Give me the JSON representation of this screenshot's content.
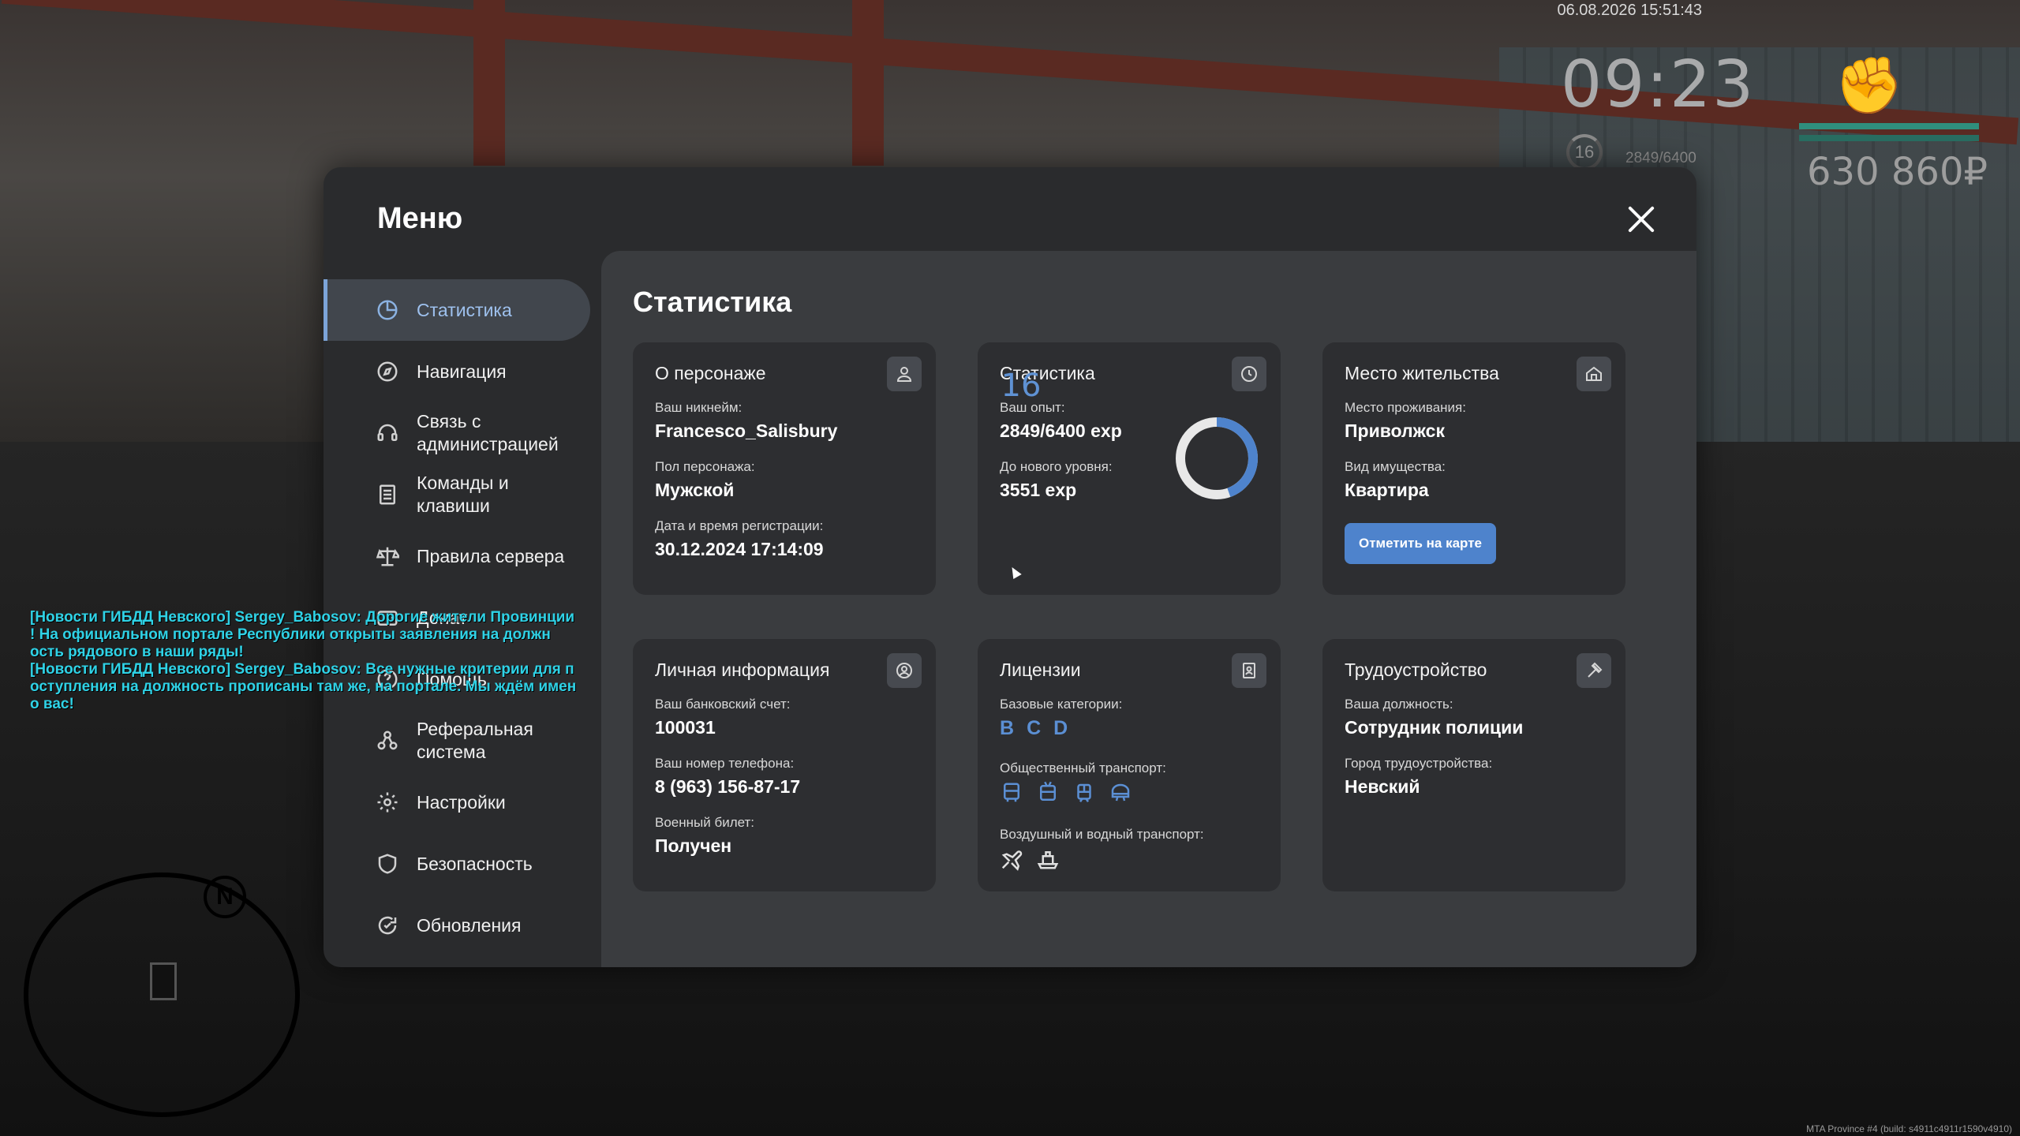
{
  "hud": {
    "datetime": "06.08.2026 15:51:43",
    "clock": "09:23",
    "level": "16",
    "exp": "2849/6400",
    "money": "630 860₽"
  },
  "chat": {
    "lines": [
      "[Новости ГИБДД Невского] Sergey_Babosov: Дорогие жители Провинции",
      "! На официальном портале Республики открыты заявления на должн",
      "ость рядового в наши ряды!",
      "[Новости ГИБДД Невского] Sergey_Babosov: Все нужные критерии для п",
      "оступления на должность прописаны там же, на портале. Мы ждём имен",
      "о вас!"
    ]
  },
  "minimap": {
    "north": "N"
  },
  "footer": {
    "build": "MTA Province #4 (build: s4911c4911r1590v4910)"
  },
  "menu": {
    "title": "Меню",
    "nav": [
      {
        "label": "Статистика",
        "icon": "pie-chart-icon",
        "active": true
      },
      {
        "label": "Навигация",
        "icon": "compass-icon"
      },
      {
        "label": "Связь с\nадминистрацией",
        "icon": "headset-icon"
      },
      {
        "label": "Команды и\nклавиши",
        "icon": "document-icon"
      },
      {
        "label": "Правила сервера",
        "icon": "scales-icon"
      },
      {
        "label": "Донат",
        "icon": "wallet-icon"
      },
      {
        "label": "Помощь",
        "icon": "help-icon"
      },
      {
        "label": "Реферальная\nсистема",
        "icon": "referral-icon"
      },
      {
        "label": "Настройки",
        "icon": "gear-icon"
      },
      {
        "label": "Безопасность",
        "icon": "shield-icon"
      },
      {
        "label": "Обновления",
        "icon": "refresh-icon"
      }
    ],
    "content_title": "Статистика",
    "cards": {
      "character": {
        "title": "О персонаже",
        "nick_label": "Ваш никнейм:",
        "nick": "Francesco_Salisbury",
        "gender_label": "Пол персонажа:",
        "gender": "Мужской",
        "reg_label": "Дата и время регистрации:",
        "reg": "30.12.2024 17:14:09"
      },
      "stats": {
        "title": "Статистика",
        "exp_label": "Ваш опыт:",
        "exp": "2849/6400 exp",
        "next_label": "До нового уровня:",
        "next": "3551 exp",
        "level": "16",
        "progress": 0.445
      },
      "residence": {
        "title": "Место жительства",
        "place_label": "Место проживания:",
        "place": "Приволжск",
        "prop_label": "Вид имущества:",
        "prop": "Квартира",
        "button": "Отметить на карте"
      },
      "personal": {
        "title": "Личная информация",
        "bank_label": "Ваш банковский счет:",
        "bank": "100031",
        "phone_label": "Ваш номер телефона:",
        "phone": "8 (963) 156-87-17",
        "military_label": "Военный билет:",
        "military": "Получен"
      },
      "licenses": {
        "title": "Лицензии",
        "base_label": "Базовые категории:",
        "categories": [
          "B",
          "C",
          "D"
        ],
        "public_label": "Общественный транспорт:",
        "air_label": "Воздушный и водный транспорт:"
      },
      "job": {
        "title": "Трудоустройство",
        "position_label": "Ваша должность:",
        "position": "Сотрудник полиции",
        "city_label": "Город трудоустройства:",
        "city": "Невский"
      }
    }
  },
  "colors": {
    "accent": "#5b8fd4",
    "chat": "#2fd2e6",
    "button": "#4e83cc"
  }
}
